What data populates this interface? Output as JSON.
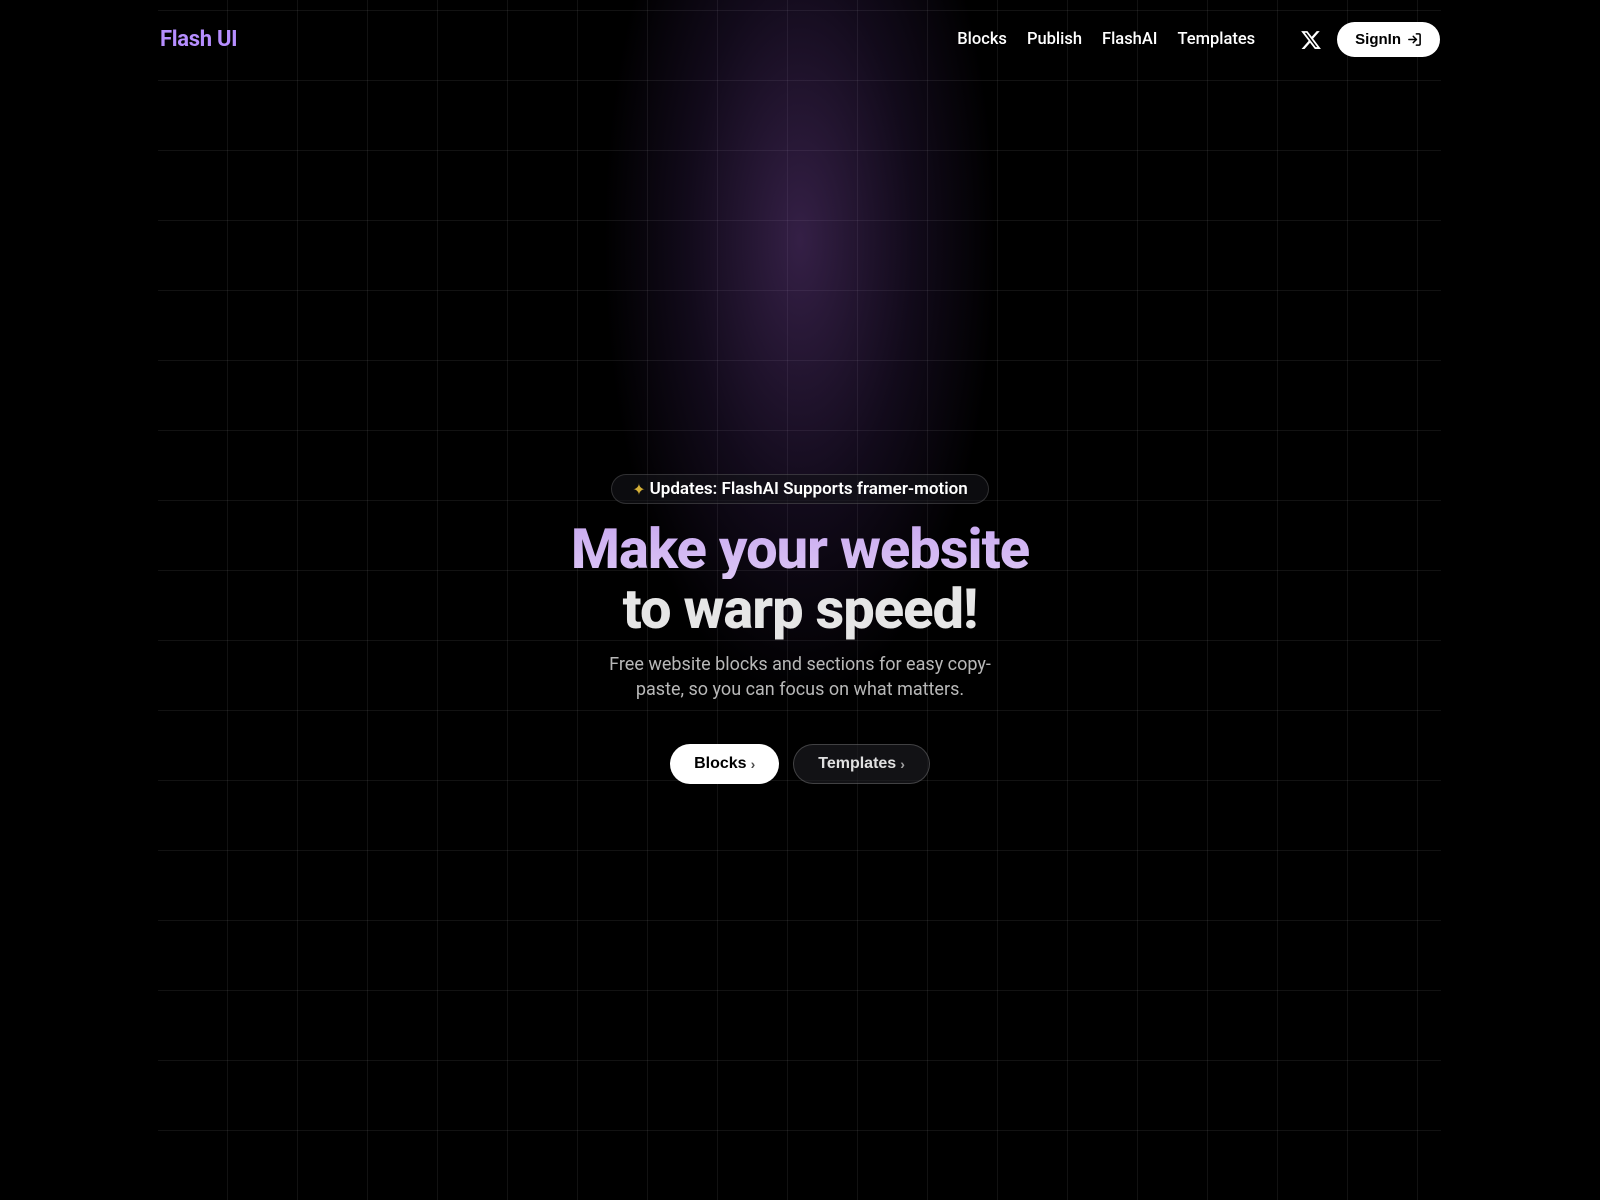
{
  "header": {
    "logo": "Flash UI",
    "nav": {
      "blocks": "Blocks",
      "publish": "Publish",
      "flashai": "FlashAI",
      "templates": "Templates"
    },
    "signin": "SignIn"
  },
  "hero": {
    "update_badge": "Updates: FlashAI Supports framer-motion",
    "title_line1": "Make your website",
    "title_line2": "to warp speed!",
    "subtitle": "Free website blocks and sections for easy copy-paste, so you can focus on what matters.",
    "btn_blocks": "Blocks",
    "btn_templates": "Templates"
  }
}
